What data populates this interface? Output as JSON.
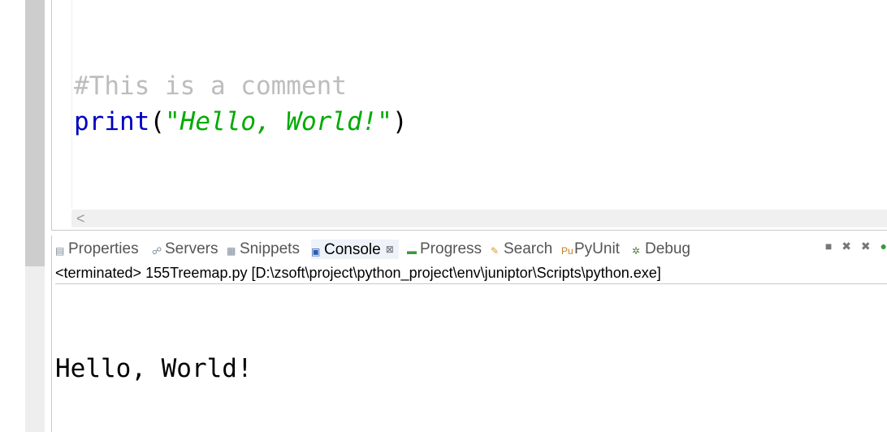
{
  "editor": {
    "code_lines": [
      {
        "comment": "#This is a comment"
      },
      {
        "func": "print",
        "open": "(",
        "string": "\"Hello, World!\"",
        "close": ")"
      }
    ],
    "hscroll_left_arrow": "<"
  },
  "views": {
    "tabs": [
      {
        "label": "Properties",
        "icon": "properties-icon"
      },
      {
        "label": "Servers",
        "icon": "servers-icon"
      },
      {
        "label": "Snippets",
        "icon": "snippets-icon"
      },
      {
        "label": "Console",
        "icon": "console-icon",
        "active": true,
        "close": "⊠"
      },
      {
        "label": "Progress",
        "icon": "progress-icon"
      },
      {
        "label": "Search",
        "icon": "search-icon"
      },
      {
        "label": "PyUnit",
        "icon": "pyunit-icon"
      },
      {
        "label": "Debug",
        "icon": "debug-icon"
      }
    ]
  },
  "console": {
    "status": "<terminated> 155Treemap.py [D:\\zsoft\\project\\python_project\\env\\juniptor\\Scripts\\python.exe]",
    "output": "Hello, World!"
  },
  "colors": {
    "comment": "#bdbdbd",
    "keyword": "#0000c0",
    "string": "#00aa00"
  }
}
